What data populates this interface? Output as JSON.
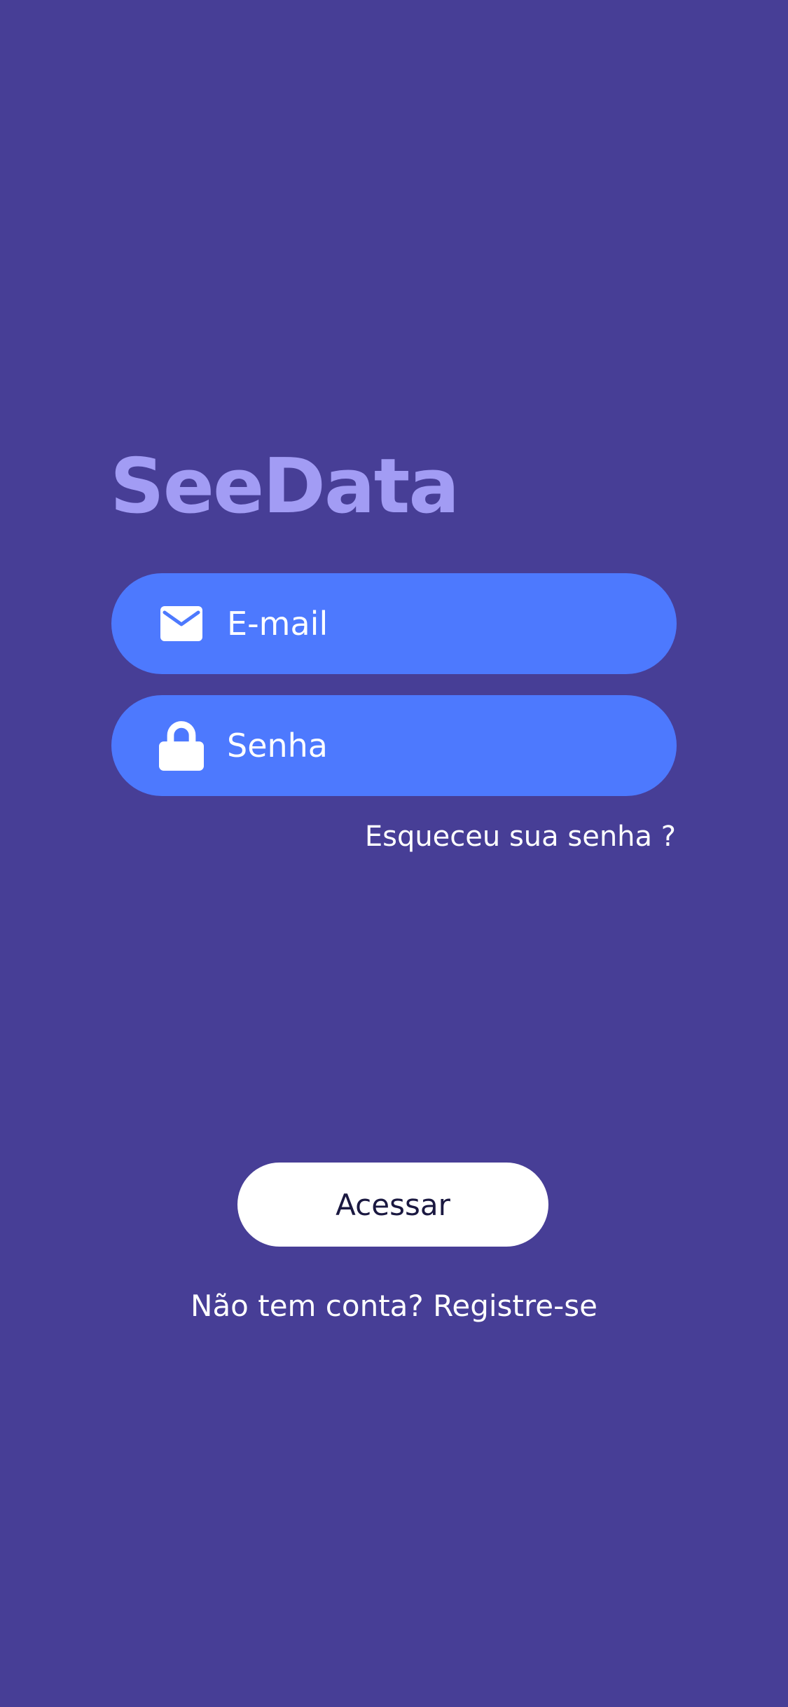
{
  "app": {
    "title": "SeeData"
  },
  "colors": {
    "background": "#473e96",
    "logo": "#a29cf4",
    "field": "#4d79fe",
    "button": "#ffffff",
    "button_text": "#1a1840",
    "text": "#ffffff"
  },
  "login": {
    "email": {
      "placeholder": "E-mail",
      "value": "",
      "icon": "envelope-icon"
    },
    "password": {
      "placeholder": "Senha",
      "value": "",
      "icon": "lock-icon"
    },
    "forgot_label": "Esqueceu sua senha ?",
    "submit_label": "Acessar",
    "no_account_text": "Não tem conta?",
    "register_label": "Registre-se"
  }
}
